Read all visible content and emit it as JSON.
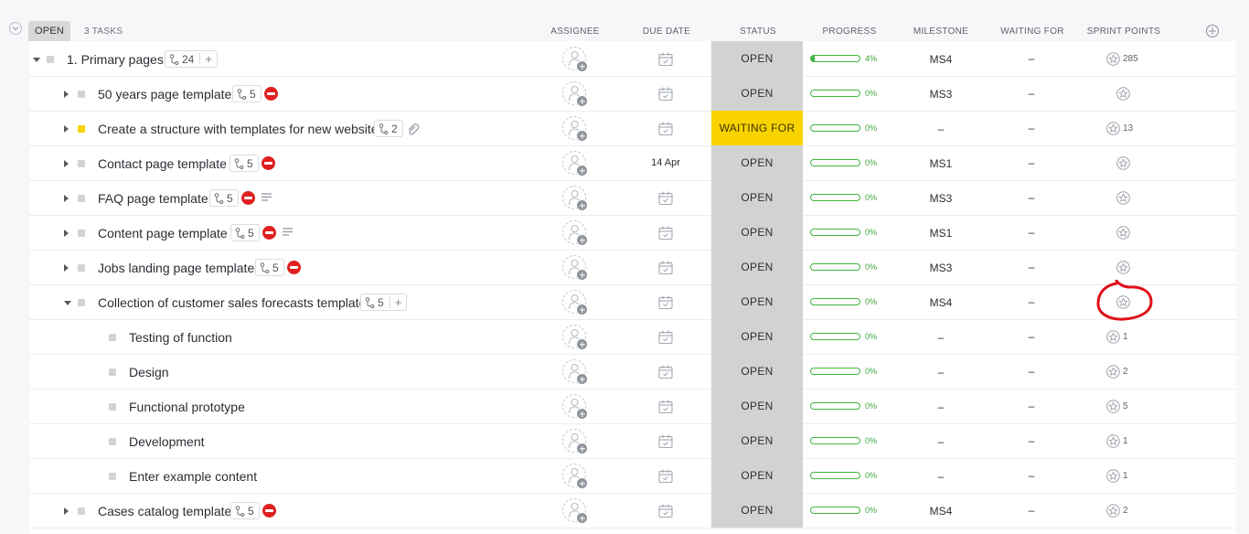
{
  "header": {
    "group_label": "OPEN",
    "task_count": "3 TASKS",
    "columns": {
      "assignee": "ASSIGNEE",
      "due_date": "DUE DATE",
      "status": "STATUS",
      "progress": "PROGRESS",
      "milestone": "MILESTONE",
      "waiting_for": "WAITING FOR",
      "sprint_points": "SPRINT POINTS"
    }
  },
  "tasks": [
    {
      "name": "1. Primary pages",
      "subtasks": "24",
      "status": "OPEN",
      "progress": "4%",
      "milestone": "MS4",
      "waiting_for": "–",
      "sprint_points": "285",
      "due": ""
    },
    {
      "name": "50 years page template",
      "subtasks": "5",
      "status": "OPEN",
      "progress": "0%",
      "milestone": "MS3",
      "waiting_for": "–",
      "sprint_points": "",
      "due": ""
    },
    {
      "name": "Create a structure with templates for new website",
      "subtasks": "2",
      "status": "WAITING FOR",
      "progress": "0%",
      "milestone": "–",
      "waiting_for": "–",
      "sprint_points": "13",
      "due": ""
    },
    {
      "name": "Contact page template",
      "subtasks": "5",
      "status": "OPEN",
      "progress": "0%",
      "milestone": "MS1",
      "waiting_for": "–",
      "sprint_points": "",
      "due": "14 Apr"
    },
    {
      "name": "FAQ page template",
      "subtasks": "5",
      "status": "OPEN",
      "progress": "0%",
      "milestone": "MS3",
      "waiting_for": "–",
      "sprint_points": "",
      "due": ""
    },
    {
      "name": "Content page template",
      "subtasks": "5",
      "status": "OPEN",
      "progress": "0%",
      "milestone": "MS1",
      "waiting_for": "–",
      "sprint_points": "",
      "due": ""
    },
    {
      "name": "Jobs landing page template",
      "subtasks": "5",
      "status": "OPEN",
      "progress": "0%",
      "milestone": "MS3",
      "waiting_for": "–",
      "sprint_points": "",
      "due": ""
    },
    {
      "name": "Collection of customer sales forecasts template",
      "subtasks": "5",
      "status": "OPEN",
      "progress": "0%",
      "milestone": "MS4",
      "waiting_for": "–",
      "sprint_points": "",
      "due": ""
    },
    {
      "name": "Testing of function",
      "subtasks": "",
      "status": "OPEN",
      "progress": "0%",
      "milestone": "–",
      "waiting_for": "–",
      "sprint_points": "1",
      "due": ""
    },
    {
      "name": "Design",
      "subtasks": "",
      "status": "OPEN",
      "progress": "0%",
      "milestone": "–",
      "waiting_for": "–",
      "sprint_points": "2",
      "due": ""
    },
    {
      "name": "Functional prototype",
      "subtasks": "",
      "status": "OPEN",
      "progress": "0%",
      "milestone": "–",
      "waiting_for": "–",
      "sprint_points": "5",
      "due": ""
    },
    {
      "name": "Development",
      "subtasks": "",
      "status": "OPEN",
      "progress": "0%",
      "milestone": "–",
      "waiting_for": "–",
      "sprint_points": "1",
      "due": ""
    },
    {
      "name": "Enter example content",
      "subtasks": "",
      "status": "OPEN",
      "progress": "0%",
      "milestone": "–",
      "waiting_for": "–",
      "sprint_points": "1",
      "due": ""
    },
    {
      "name": "Cases catalog template",
      "subtasks": "5",
      "status": "OPEN",
      "progress": "0%",
      "milestone": "MS4",
      "waiting_for": "–",
      "sprint_points": "2",
      "due": ""
    }
  ],
  "progress_fractions": [
    0.04,
    0,
    0,
    0,
    0,
    0,
    0,
    0,
    0,
    0,
    0,
    0,
    0,
    0
  ],
  "colors": {
    "status_open": "#d2d2d2",
    "status_waiting": "#f9d300",
    "progress_green": "#3fb43f",
    "blocked_red": "#e02020",
    "annotation_red": "#e0101a"
  }
}
